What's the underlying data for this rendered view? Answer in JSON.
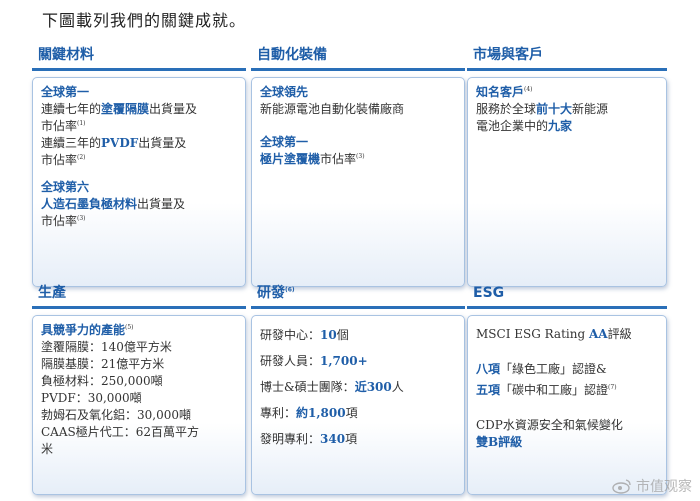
{
  "intro": "下圖載列我們的關鍵成就。",
  "sections": {
    "materials": {
      "title": "關鍵材料",
      "b1_head": "全球第一",
      "b1_l1_a": "連續七年的",
      "b1_l1_b": "塗覆隔膜",
      "b1_l1_c": "出貨量及",
      "b1_l2": "市佔率",
      "b1_l2_sup": "(1)",
      "b1_l3_a": "連續三年的",
      "b1_l3_b": "PVDF",
      "b1_l3_c": "出貨量及",
      "b1_l4": "市佔率",
      "b1_l4_sup": "(2)",
      "b2_head": "全球第六",
      "b2_l1_a": "人造石墨負極材料",
      "b2_l1_b": "出貨量及",
      "b2_l2": "市佔率",
      "b2_l2_sup": "(3)"
    },
    "automation": {
      "title": "自動化裝備",
      "b1_head": "全球領先",
      "b1_l1": "新能源電池自動化裝備廠商",
      "b2_head": "全球第一",
      "b2_l1_a": "極片塗覆機",
      "b2_l1_b": "市佔率",
      "b2_l1_sup": "(3)"
    },
    "market": {
      "title": "市場與客戶",
      "head": "知名客戶",
      "head_sup": "(4)",
      "l1_a": "服務於全球",
      "l1_b": "前十大",
      "l1_c": "新能源",
      "l2_a": "電池企業中的",
      "l2_b": "九家"
    },
    "production": {
      "title": "生產",
      "head": "具競爭力的產能",
      "head_sup": "(5)",
      "lines": [
        "塗覆隔膜：140億平方米",
        "隔膜基膜：21億平方米",
        "負極材料：250,000噸",
        "PVDF：30,000噸",
        "勃姆石及氧化鋁：30,000噸",
        "CAAS極片代工：62百萬平方",
        "米"
      ]
    },
    "rnd": {
      "title": "研發",
      "title_sup": "(6)",
      "r1_a": "研發中心：",
      "r1_b": "10",
      "r1_c": "個",
      "r2_a": "研發人員：",
      "r2_b": "1,700+",
      "r3_a": "博士&碩士團隊：",
      "r3_b": "近300",
      "r3_c": "人",
      "r4_a": "專利：",
      "r4_b": "約1,800",
      "r4_c": "項",
      "r5_a": "發明專利：",
      "r5_b": "340",
      "r5_c": "項"
    },
    "esg": {
      "title": "ESG",
      "l1_a": "MSCI ESG Rating ",
      "l1_b": "AA",
      "l1_c": "評級",
      "l2_a": "八項",
      "l2_b": "「綠色工廠」認證&",
      "l3_a": "五項",
      "l3_b": "「碳中和工廠」認證",
      "l3_sup": "(7)",
      "l4": "CDP水資源安全和氣候變化",
      "l5_a": "雙B",
      "l5_b": "評級"
    }
  },
  "watermark": "市值观察"
}
